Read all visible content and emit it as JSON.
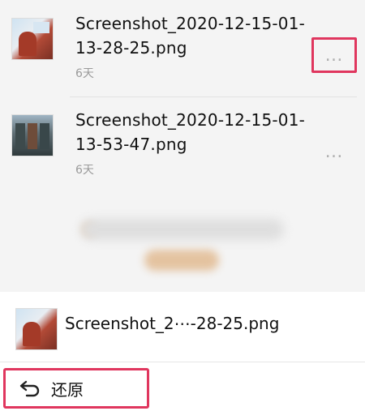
{
  "files": [
    {
      "name_line1": "Screenshot_2020-12-15-01-",
      "name_line2": "13-28-25.png",
      "age": "6天",
      "more_icon": "…"
    },
    {
      "name_line1": "Screenshot_2020-12-15-01-",
      "name_line2": "13-53-47.png",
      "age": "6天",
      "more_icon": "…"
    }
  ],
  "sheet": {
    "file_name": "Screenshot_2⋯-28-25.png",
    "restore_label": "还原",
    "restore_icon": "undo-arrow-icon"
  },
  "colors": {
    "highlight": "#e0365e",
    "dim_background": "#f4f4f4"
  }
}
